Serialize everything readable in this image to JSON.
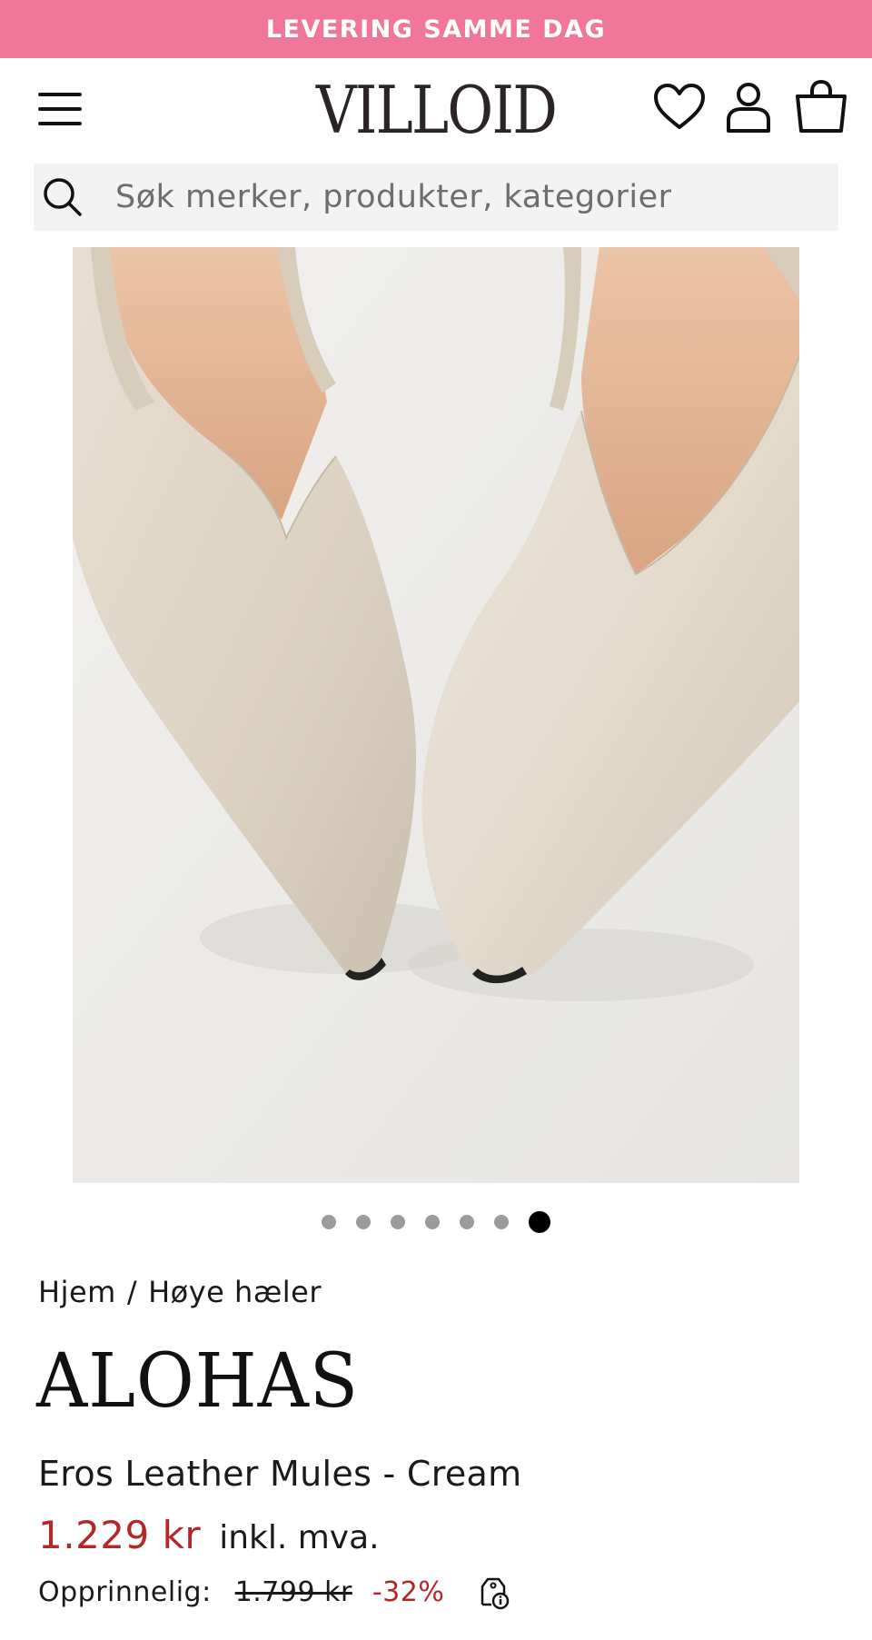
{
  "promo": {
    "text": "LEVERING SAMME DAG",
    "bg_color": "#f0769a"
  },
  "header": {
    "logo": "VILLOID",
    "icons": [
      "menu-icon",
      "heart-icon",
      "user-icon",
      "shopping-bag-icon"
    ]
  },
  "search": {
    "placeholder": "Søk merker, produkter, kategorier",
    "icon": "search-icon"
  },
  "gallery": {
    "image_alt": "Eros Leather Mules - Cream",
    "dots_total": 7,
    "active_dot": 7
  },
  "breadcrumb": {
    "home": "Hjem",
    "separator": "/",
    "category": "Høye hæler"
  },
  "product": {
    "brand": "ALOHAS",
    "name": "Eros Leather Mules - Cream",
    "price": "1.229 kr",
    "vat_note": "inkl. mva.",
    "original_label": "Opprinnelig:",
    "original_price": "1.799 kr",
    "discount": "-32%",
    "price_color": "#b3272b"
  }
}
